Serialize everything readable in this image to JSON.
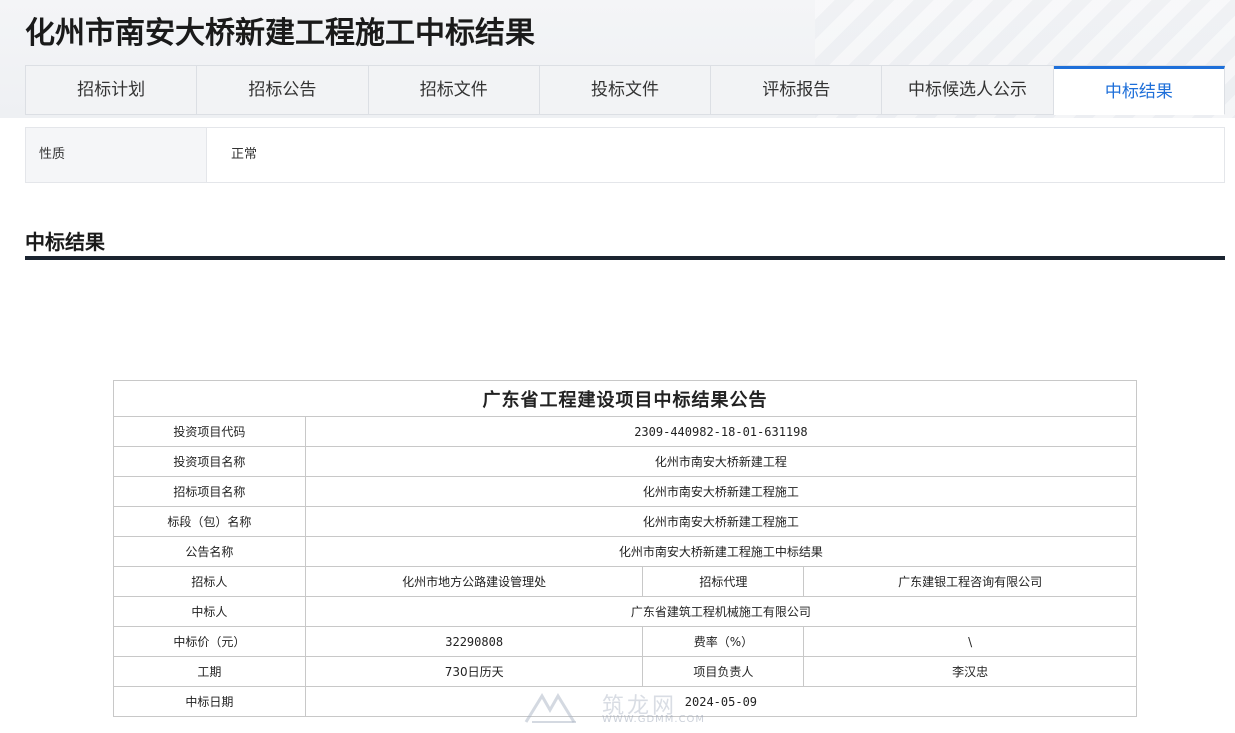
{
  "page": {
    "title": "化州市南安大桥新建工程施工中标结果"
  },
  "tabs": [
    {
      "label": "招标计划"
    },
    {
      "label": "招标公告"
    },
    {
      "label": "招标文件"
    },
    {
      "label": "投标文件"
    },
    {
      "label": "评标报告"
    },
    {
      "label": "中标候选人公示"
    },
    {
      "label": "中标结果",
      "active": true
    }
  ],
  "info": {
    "label": "性质",
    "value": "正常"
  },
  "section": {
    "title": "中标结果"
  },
  "notice": {
    "caption": "广东省工程建设项目中标结果公告",
    "rows": {
      "project_code": {
        "label": "投资项目代码",
        "value": "2309-440982-18-01-631198"
      },
      "project_name": {
        "label": "投资项目名称",
        "value": "化州市南安大桥新建工程"
      },
      "tender_name": {
        "label": "招标项目名称",
        "value": "化州市南安大桥新建工程施工"
      },
      "lot_name": {
        "label": "标段（包）名称",
        "value": "化州市南安大桥新建工程施工"
      },
      "notice_name": {
        "label": "公告名称",
        "value": "化州市南安大桥新建工程施工中标结果"
      },
      "tenderer": {
        "label": "招标人",
        "value": "化州市地方公路建设管理处",
        "label2": "招标代理",
        "value2": "广东建银工程咨询有限公司"
      },
      "winner": {
        "label": "中标人",
        "value": "广东省建筑工程机械施工有限公司"
      },
      "price": {
        "label": "中标价（元）",
        "value": "32290808",
        "label2": "费率（%）",
        "value2": "\\"
      },
      "duration": {
        "label": "工期",
        "value": "730日历天",
        "label2": "项目负责人",
        "value2": "李汉忠"
      },
      "date": {
        "label": "中标日期",
        "value": "2024-05-09"
      }
    }
  },
  "watermark": {
    "text": "筑龙网",
    "url": "WWW.GDMM.COM"
  }
}
